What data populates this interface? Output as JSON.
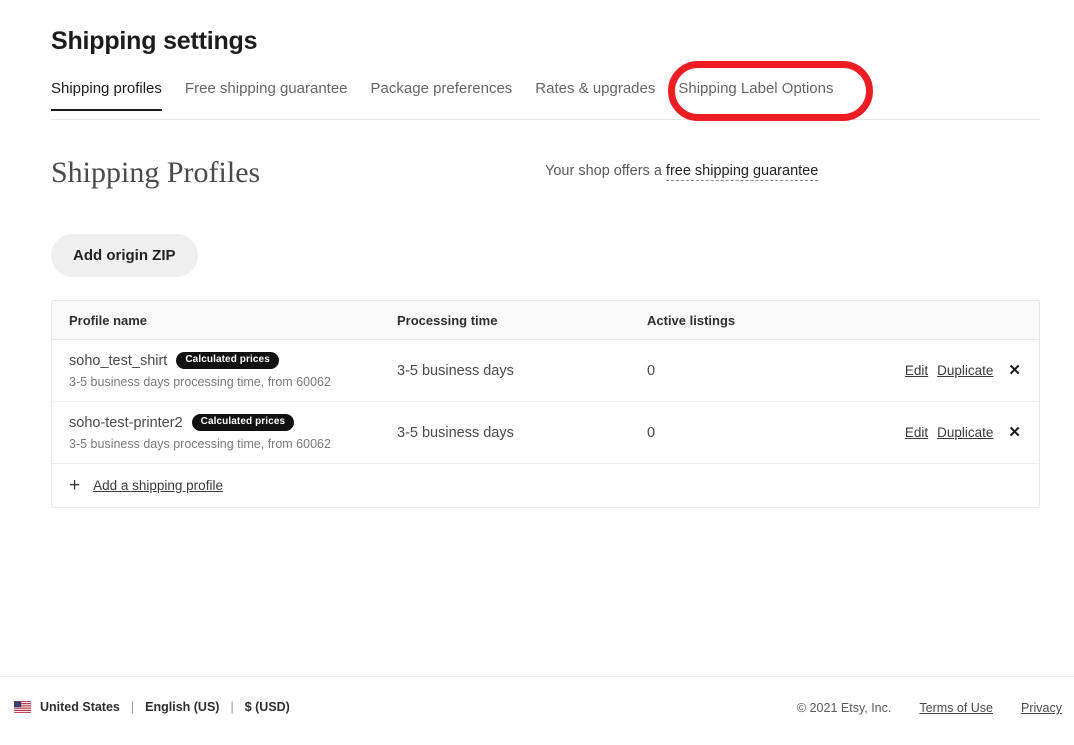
{
  "header": {
    "title": "Shipping settings"
  },
  "tabs": [
    {
      "label": "Shipping profiles",
      "active": true
    },
    {
      "label": "Free shipping guarantee",
      "active": false
    },
    {
      "label": "Package preferences",
      "active": false
    },
    {
      "label": "Rates & upgrades",
      "active": false
    },
    {
      "label": "Shipping Label Options",
      "active": false
    }
  ],
  "section": {
    "heading": "Shipping Profiles",
    "offers_prefix": "Your shop offers a ",
    "offers_link": "free shipping guarantee",
    "add_origin_zip_label": "Add origin ZIP"
  },
  "table": {
    "columns": {
      "profile_name": "Profile name",
      "processing_time": "Processing time",
      "active_listings": "Active listings"
    },
    "rows": [
      {
        "name": "soho_test_shirt",
        "badge": "Calculated prices",
        "subtitle": "3-5 business days processing time, from 60062",
        "processing_time": "3-5 business days",
        "active_listings": "0",
        "edit_label": "Edit",
        "duplicate_label": "Duplicate",
        "remove_label": "✕"
      },
      {
        "name": "soho-test-printer2",
        "badge": "Calculated prices",
        "subtitle": "3-5 business days processing time, from 60062",
        "processing_time": "3-5 business days",
        "active_listings": "0",
        "edit_label": "Edit",
        "duplicate_label": "Duplicate",
        "remove_label": "✕"
      }
    ],
    "add_profile_label": "Add a shipping profile",
    "add_profile_icon": "+"
  },
  "footer": {
    "country": "United States",
    "language": "English (US)",
    "currency": "$ (USD)",
    "separator": "|",
    "copyright": "© 2021 Etsy, Inc.",
    "terms_label": "Terms of Use",
    "privacy_label": "Privacy"
  },
  "annotation": {
    "target": "Shipping Label Options",
    "color": "#ee1d23",
    "shape": "rounded-rect-outline"
  }
}
